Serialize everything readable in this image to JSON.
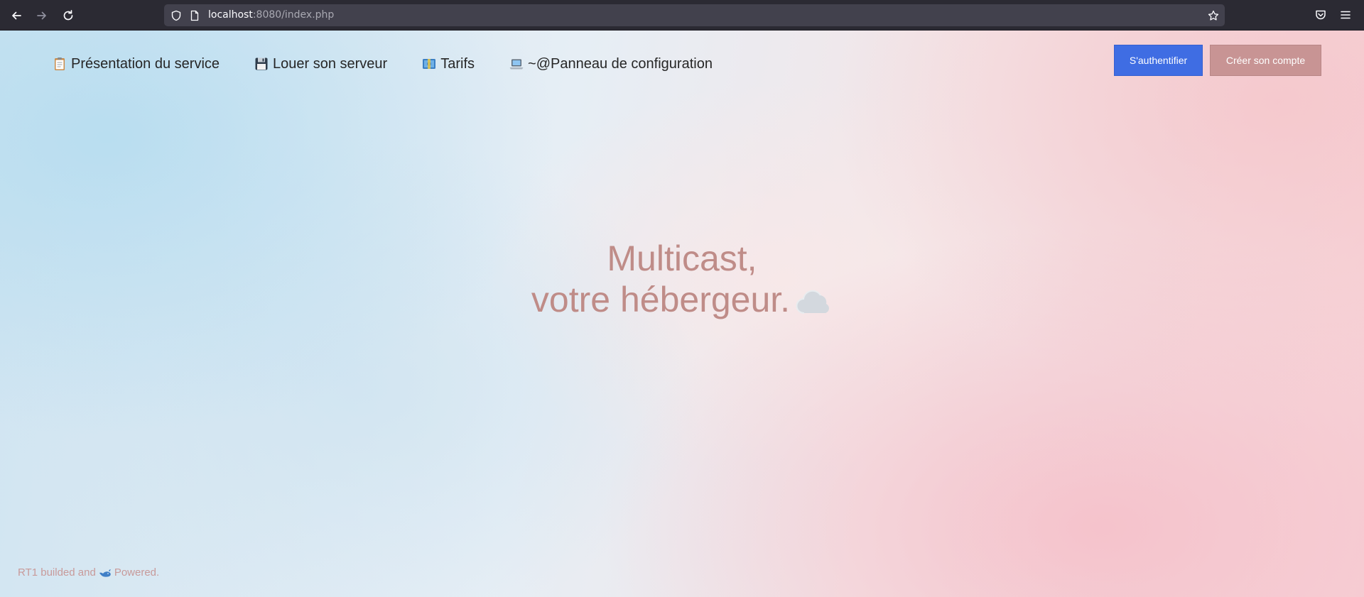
{
  "browser": {
    "url_host": "localhost",
    "url_rest": ":8080/index.php"
  },
  "nav": {
    "items": [
      {
        "label": "Présentation du service",
        "icon": "clipboard-icon"
      },
      {
        "label": "Louer son serveur",
        "icon": "floppy-disk-icon"
      },
      {
        "label": "Tarifs",
        "icon": "banknote-icon"
      },
      {
        "label": "~@Panneau de configuration",
        "icon": "laptop-icon"
      }
    ]
  },
  "auth": {
    "login_label": "S'authentifier",
    "signup_label": "Créer son compte"
  },
  "hero": {
    "line1": "Multicast,",
    "line2": "votre hébergeur.",
    "icon": "cloud-icon"
  },
  "footer": {
    "text_before": "RT1 builded and",
    "text_after": "Powered.",
    "icon": "whale-icon"
  },
  "colors": {
    "login_button": "#3f6de3",
    "signup_button": "#c89494",
    "hero_text": "#bf8c88",
    "footer_text": "#c89a9a"
  }
}
